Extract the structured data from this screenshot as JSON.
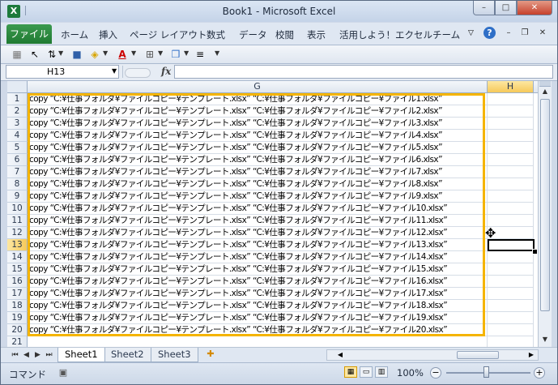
{
  "window": {
    "title": "Book1  -  Microsoft Excel",
    "app_icon": "X",
    "buttons": {
      "minimize": "–",
      "maximize": "□",
      "close": "✕"
    }
  },
  "ribbon": {
    "file_tab": "ファイル",
    "tabs": [
      "ホーム",
      "挿入",
      "ページ レイアウト",
      "数式",
      "データ",
      "校閲",
      "表示",
      "活用しよう！エクセル",
      "チーム"
    ],
    "help": "?"
  },
  "formula_bar": {
    "name_box": "H13",
    "fx": "fx",
    "formula": ""
  },
  "grid": {
    "columns": [
      {
        "label": "G",
        "active": false
      },
      {
        "label": "H",
        "active": true
      }
    ],
    "rows": [
      {
        "num": "1",
        "text": "copy “C:¥仕事フォルダ¥ファイルコピー¥テンプレート.xlsx” “C:¥仕事フォルダ¥ファイルコピー¥ファイル1.xlsx”"
      },
      {
        "num": "2",
        "text": "copy “C:¥仕事フォルダ¥ファイルコピー¥テンプレート.xlsx” “C:¥仕事フォルダ¥ファイルコピー¥ファイル2.xlsx”"
      },
      {
        "num": "3",
        "text": "copy “C:¥仕事フォルダ¥ファイルコピー¥テンプレート.xlsx” “C:¥仕事フォルダ¥ファイルコピー¥ファイル3.xlsx”"
      },
      {
        "num": "4",
        "text": "copy “C:¥仕事フォルダ¥ファイルコピー¥テンプレート.xlsx” “C:¥仕事フォルダ¥ファイルコピー¥ファイル4.xlsx”"
      },
      {
        "num": "5",
        "text": "copy “C:¥仕事フォルダ¥ファイルコピー¥テンプレート.xlsx” “C:¥仕事フォルダ¥ファイルコピー¥ファイル5.xlsx”"
      },
      {
        "num": "6",
        "text": "copy “C:¥仕事フォルダ¥ファイルコピー¥テンプレート.xlsx” “C:¥仕事フォルダ¥ファイルコピー¥ファイル6.xlsx”"
      },
      {
        "num": "7",
        "text": "copy “C:¥仕事フォルダ¥ファイルコピー¥テンプレート.xlsx” “C:¥仕事フォルダ¥ファイルコピー¥ファイル7.xlsx”"
      },
      {
        "num": "8",
        "text": "copy “C:¥仕事フォルダ¥ファイルコピー¥テンプレート.xlsx” “C:¥仕事フォルダ¥ファイルコピー¥ファイル8.xlsx”"
      },
      {
        "num": "9",
        "text": "copy “C:¥仕事フォルダ¥ファイルコピー¥テンプレート.xlsx” “C:¥仕事フォルダ¥ファイルコピー¥ファイル9.xlsx”"
      },
      {
        "num": "10",
        "text": "copy “C:¥仕事フォルダ¥ファイルコピー¥テンプレート.xlsx” “C:¥仕事フォルダ¥ファイルコピー¥ファイル10.xlsx”"
      },
      {
        "num": "11",
        "text": "copy “C:¥仕事フォルダ¥ファイルコピー¥テンプレート.xlsx” “C:¥仕事フォルダ¥ファイルコピー¥ファイル11.xlsx”"
      },
      {
        "num": "12",
        "text": "copy “C:¥仕事フォルダ¥ファイルコピー¥テンプレート.xlsx” “C:¥仕事フォルダ¥ファイルコピー¥ファイル12.xlsx”"
      },
      {
        "num": "13",
        "text": "copy “C:¥仕事フォルダ¥ファイルコピー¥テンプレート.xlsx” “C:¥仕事フォルダ¥ファイルコピー¥ファイル13.xlsx”"
      },
      {
        "num": "14",
        "text": "copy “C:¥仕事フォルダ¥ファイルコピー¥テンプレート.xlsx” “C:¥仕事フォルダ¥ファイルコピー¥ファイル14.xlsx”"
      },
      {
        "num": "15",
        "text": "copy “C:¥仕事フォルダ¥ファイルコピー¥テンプレート.xlsx” “C:¥仕事フォルダ¥ファイルコピー¥ファイル15.xlsx”"
      },
      {
        "num": "16",
        "text": "copy “C:¥仕事フォルダ¥ファイルコピー¥テンプレート.xlsx” “C:¥仕事フォルダ¥ファイルコピー¥ファイル16.xlsx”"
      },
      {
        "num": "17",
        "text": "copy “C:¥仕事フォルダ¥ファイルコピー¥テンプレート.xlsx” “C:¥仕事フォルダ¥ファイルコピー¥ファイル17.xlsx”"
      },
      {
        "num": "18",
        "text": "copy “C:¥仕事フォルダ¥ファイルコピー¥テンプレート.xlsx” “C:¥仕事フォルダ¥ファイルコピー¥ファイル18.xlsx”"
      },
      {
        "num": "19",
        "text": "copy “C:¥仕事フォルダ¥ファイルコピー¥テンプレート.xlsx” “C:¥仕事フォルダ¥ファイルコピー¥ファイル19.xlsx”"
      },
      {
        "num": "20",
        "text": "copy “C:¥仕事フォルダ¥ファイルコピー¥テンプレート.xlsx” “C:¥仕事フォルダ¥ファイルコピー¥ファイル20.xlsx”"
      },
      {
        "num": "21",
        "text": ""
      }
    ],
    "active_row": "13",
    "active_column": "H"
  },
  "sheets": {
    "tabs": [
      {
        "label": "Sheet1",
        "active": true
      },
      {
        "label": "Sheet2",
        "active": false
      },
      {
        "label": "Sheet3",
        "active": false
      }
    ]
  },
  "status_bar": {
    "mode": "コマンド",
    "zoom": "100%",
    "zoom_minus": "−",
    "zoom_plus": "+"
  },
  "colors": {
    "selection_border": "#f5b400",
    "file_tab": "#1f7a32",
    "active_header": "#f6c95a"
  },
  "icons": [
    "excel-app-icon",
    "help-icon",
    "save-icon",
    "fill-color-icon",
    "font-color-icon",
    "borders-icon",
    "shapes-icon",
    "align-icon",
    "fx-icon",
    "new-sheet-icon"
  ]
}
